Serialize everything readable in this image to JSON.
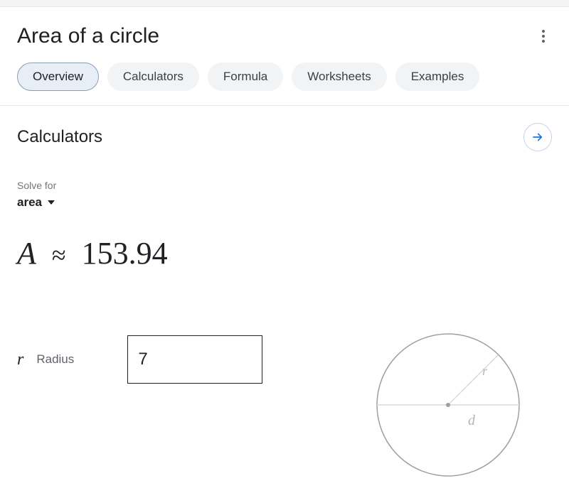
{
  "header": {
    "title": "Area of a circle"
  },
  "tabs": [
    {
      "label": "Overview",
      "active": true
    },
    {
      "label": "Calculators",
      "active": false
    },
    {
      "label": "Formula",
      "active": false
    },
    {
      "label": "Worksheets",
      "active": false
    },
    {
      "label": "Examples",
      "active": false
    }
  ],
  "calculator": {
    "section_title": "Calculators",
    "solve_for_label": "Solve for",
    "solve_for_value": "area",
    "result": {
      "symbol": "A",
      "relation": "≈",
      "value": "153.94"
    },
    "input": {
      "symbol": "r",
      "label": "Radius",
      "value": "7"
    },
    "diagram": {
      "r_label": "r",
      "d_label": "d"
    }
  }
}
